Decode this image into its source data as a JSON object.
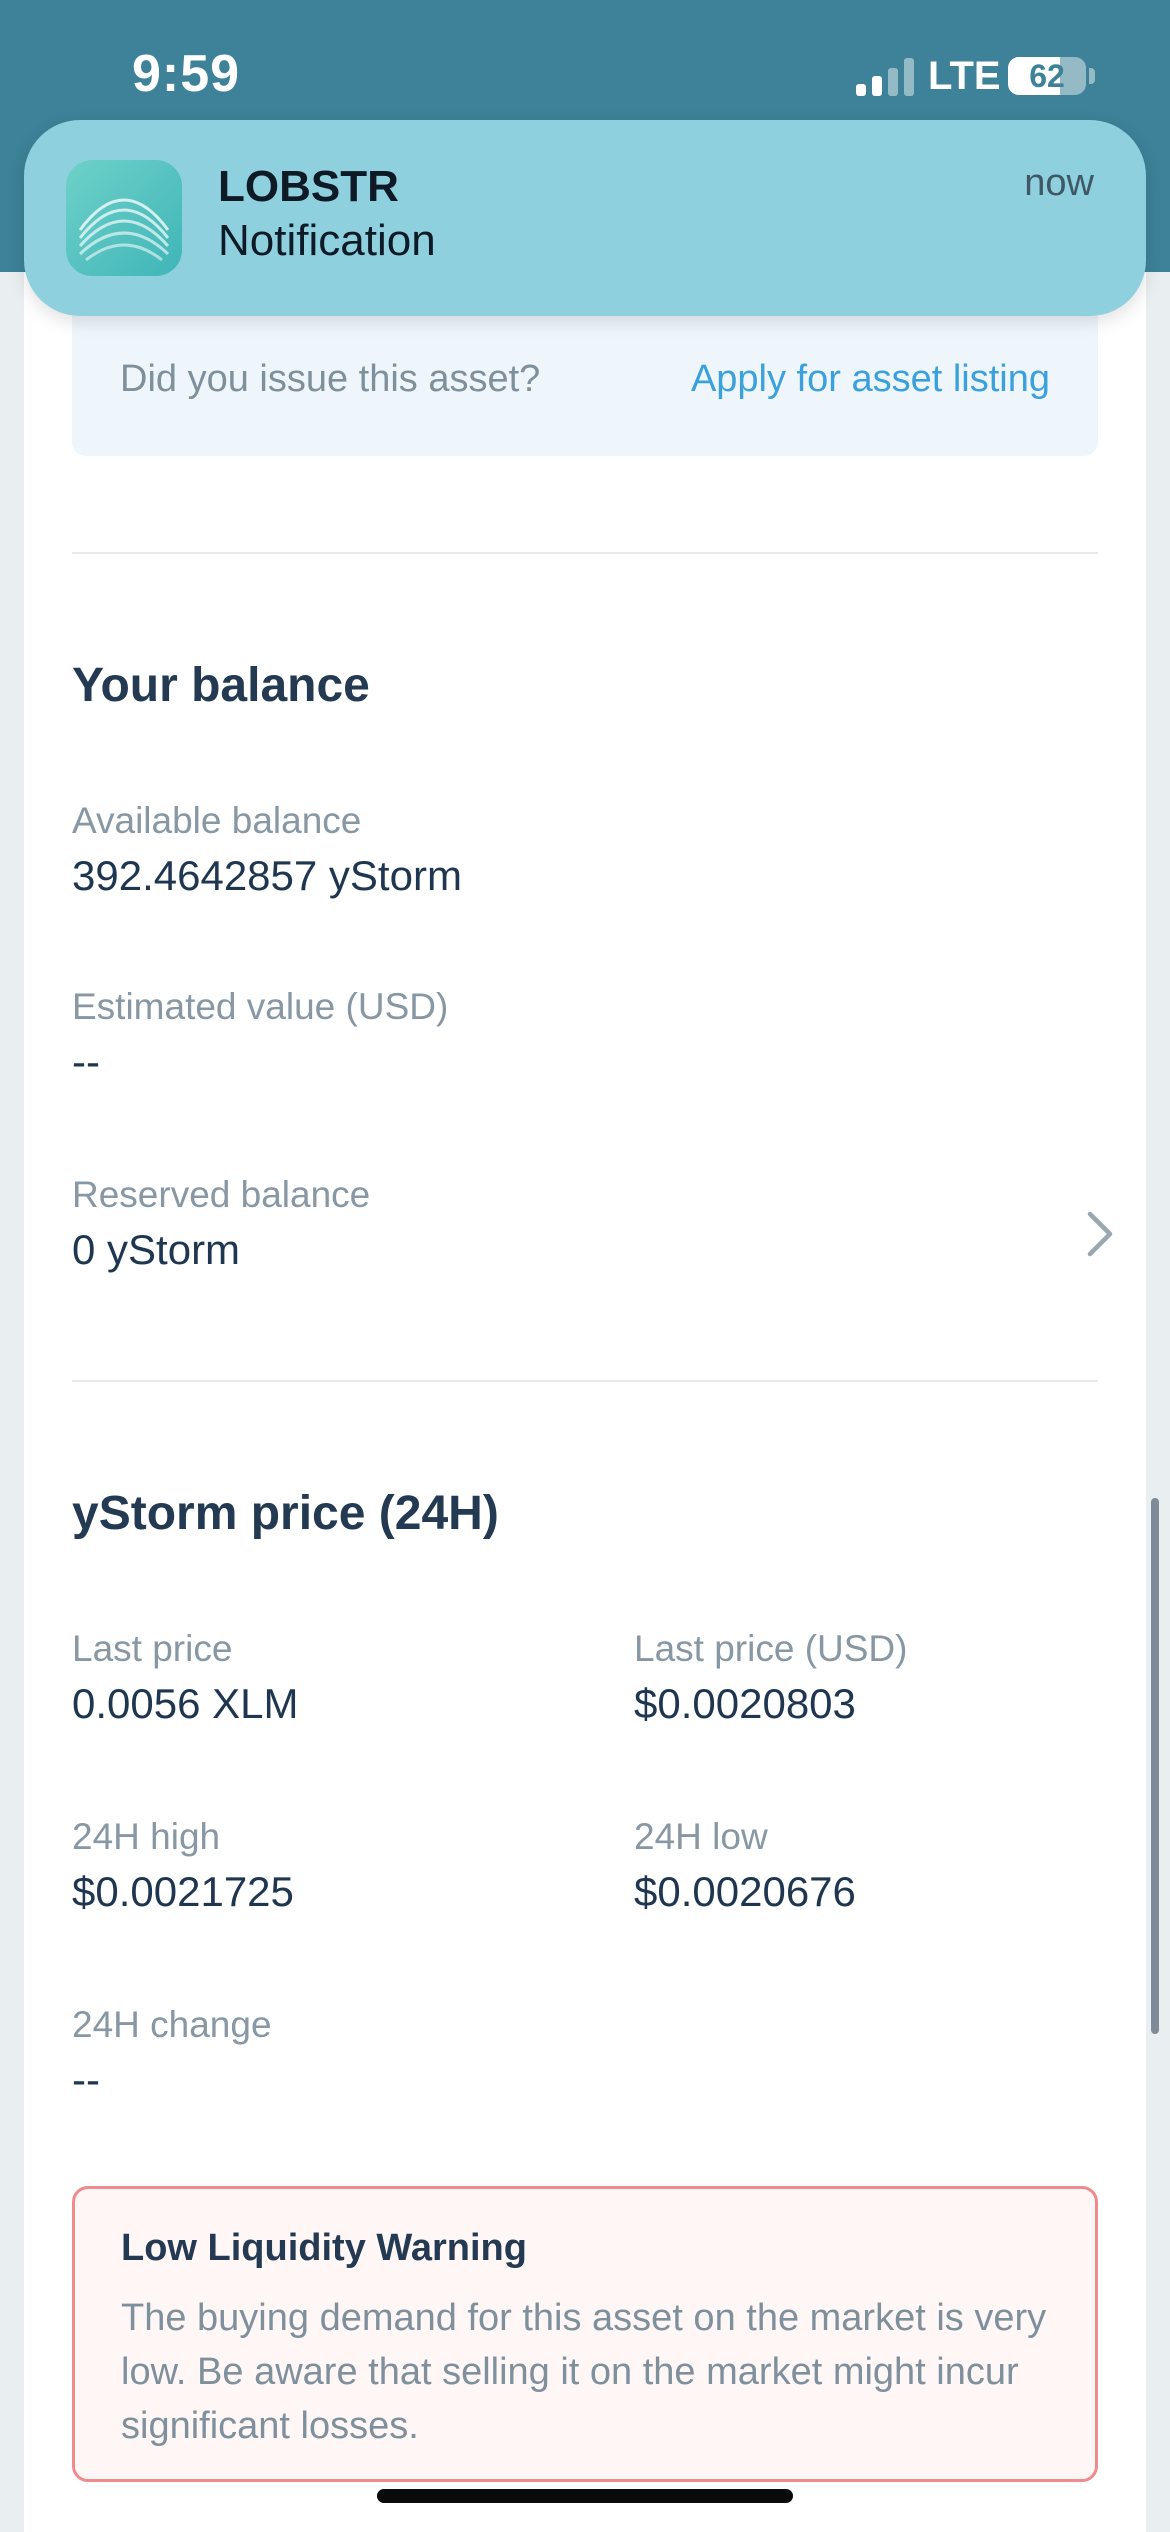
{
  "status_bar": {
    "time": "9:59",
    "network": "LTE",
    "battery": "62",
    "signal_bars_active": 2,
    "signal_bars_total": 4
  },
  "notification": {
    "app": "LOBSTR",
    "body": "Notification",
    "time": "now"
  },
  "asset_listing": {
    "question": "Did you issue this asset?",
    "link": "Apply for asset listing"
  },
  "balance": {
    "title": "Your balance",
    "available_label": "Available balance",
    "available_value": "392.4642857 yStorm",
    "estimated_label": "Estimated value (USD)",
    "estimated_value": "--",
    "reserved_label": "Reserved balance",
    "reserved_value": "0 yStorm"
  },
  "price": {
    "title": "yStorm price (24H)",
    "last_price_label": "Last price",
    "last_price_value": "0.0056 XLM",
    "last_price_usd_label": "Last price (USD)",
    "last_price_usd_value": "$0.0020803",
    "high_label": "24H high",
    "high_value": "$0.0021725",
    "low_label": "24H low",
    "low_value": "$0.0020676",
    "change_label": "24H change",
    "change_value": "--"
  },
  "warning": {
    "title": "Low Liquidity Warning",
    "text": "The buying demand for this asset on the market is very low. Be aware that selling it on the market might incur significant losses."
  },
  "colors": {
    "header_teal": "#3d8298",
    "notification_bg": "#8fd0df",
    "link_blue": "#3ba1dd",
    "warning_border": "#f08a8c"
  }
}
